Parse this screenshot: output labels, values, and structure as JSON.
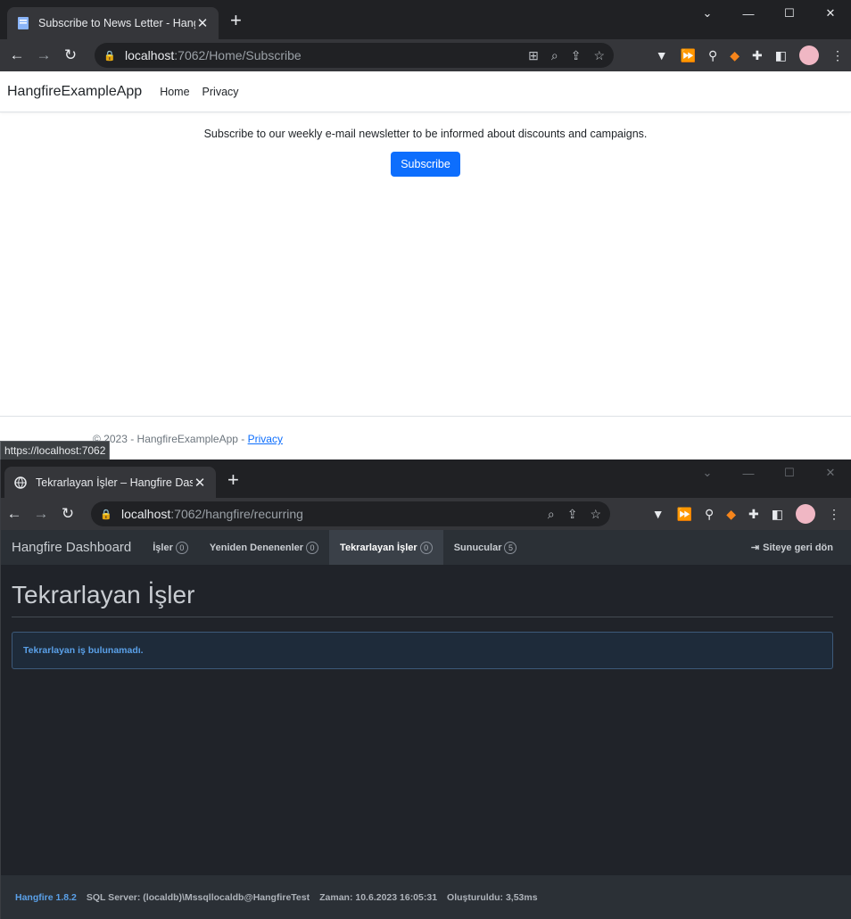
{
  "window1": {
    "tab_title": "Subscribe to News Letter - Hangfi",
    "url_host": "localhost",
    "url_path": ":7062/Home/Subscribe",
    "site": {
      "brand": "HangfireExampleApp",
      "nav": [
        "Home",
        "Privacy"
      ],
      "lead": "Subscribe to our weekly e-mail newsletter to be informed about discounts and campaigns.",
      "button": "Subscribe",
      "footer_text": "© 2023 - HangfireExampleApp - ",
      "footer_link": "Privacy"
    },
    "status_url": "https://localhost:7062"
  },
  "window2": {
    "tab_title": "Tekrarlayan İşler – Hangfire Dashb",
    "url_host": "localhost",
    "url_path": ":7062/hangfire/recurring",
    "hangfire": {
      "brand": "Hangfire Dashboard",
      "nav": [
        {
          "label": "İşler",
          "count": "0"
        },
        {
          "label": "Yeniden Denenenler",
          "count": "0"
        },
        {
          "label": "Tekrarlayan İşler",
          "count": "0"
        },
        {
          "label": "Sunucular",
          "count": "5"
        }
      ],
      "back_label": "Siteye geri dön",
      "page_title": "Tekrarlayan İşler",
      "alert": "Tekrarlayan iş bulunamadı.",
      "footer": {
        "version": "Hangfire 1.8.2",
        "storage": "SQL Server: (localdb)\\Mssqllocaldb@HangfireTest",
        "time": "Zaman: 10.6.2023 16:05:31",
        "generated": "Oluşturuldu: 3,53ms"
      }
    }
  },
  "colors": {
    "primary_button": "#0d6efd",
    "hangfire_bg": "#202329",
    "hangfire_accent": "#5aa0e8"
  }
}
